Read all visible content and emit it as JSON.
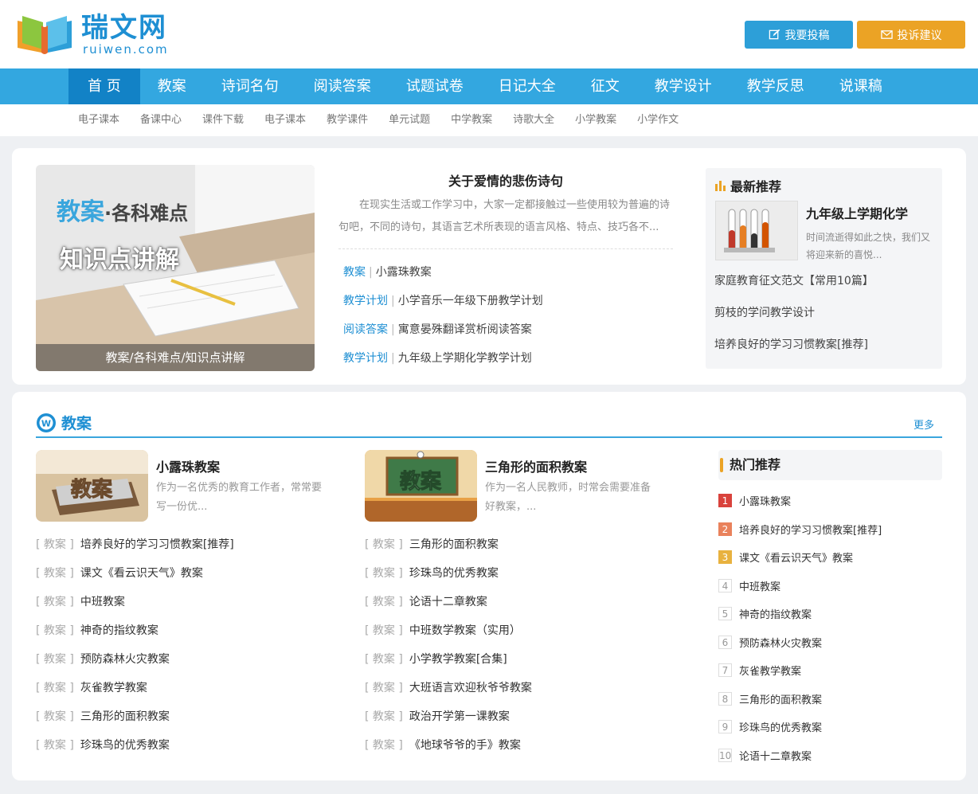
{
  "header": {
    "logo_text": "瑞文网",
    "logo_sub": "ruiwen.com",
    "btn_submit": "我要投稿",
    "btn_feedback": "投诉建议"
  },
  "nav": {
    "items": [
      "首 页",
      "教案",
      "诗词名句",
      "阅读答案",
      "试题试卷",
      "日记大全",
      "征文",
      "教学设计",
      "教学反思",
      "说课稿"
    ]
  },
  "subnav": {
    "items": [
      "电子课本",
      "备课中心",
      "课件下载",
      "电子课本",
      "教学课件",
      "单元试题",
      "中学教案",
      "诗歌大全",
      "小学教案",
      "小学作文"
    ]
  },
  "banner": {
    "title_main": "教案",
    "title_dot": "·各科难点",
    "title_sub": "知识点讲解",
    "caption": "教案/各科难点/知识点讲解"
  },
  "article": {
    "title": "关于爱情的悲伤诗句",
    "desc": "在现实生活或工作学习中，大家一定都接触过一些使用较为普遍的诗句吧，不同的诗句，其语言艺术所表现的语言风格、特点、技巧各不...",
    "links": [
      {
        "tag": "教案",
        "text": "小露珠教案"
      },
      {
        "tag": "教学计划",
        "text": "小学音乐一年级下册教学计划"
      },
      {
        "tag": "阅读答案",
        "text": "寓意晏殊翻译赏析阅读答案"
      },
      {
        "tag": "教学计划",
        "text": "九年级上学期化学教学计划"
      }
    ]
  },
  "latest": {
    "heading": "最新推荐",
    "top_title": "九年级上学期化学",
    "top_desc": "时间流逝得如此之快，我们又将迎来新的喜悦...",
    "items": [
      "家庭教育征文范文【常用10篇】",
      "剪枝的学问教学设计",
      "培养良好的学习习惯教案[推荐]"
    ]
  },
  "section": {
    "title": "教案",
    "more": "更多",
    "feature1": {
      "img_text": "教案",
      "title": "小露珠教案",
      "desc": "作为一名优秀的教育工作者，常常要写一份优..."
    },
    "feature2": {
      "img_text": "教案",
      "title": "三角形的面积教案",
      "desc": "作为一名人民教师，时常会需要准备好教案，..."
    },
    "tag": "[ 教案 ]",
    "list1": [
      "培养良好的学习习惯教案[推荐]",
      "课文《看云识天气》教案",
      "中班教案",
      "神奇的指纹教案",
      "预防森林火灾教案",
      "灰雀教学教案",
      "三角形的面积教案",
      "珍珠鸟的优秀教案"
    ],
    "list2": [
      "三角形的面积教案",
      "珍珠鸟的优秀教案",
      "论语十二章教案",
      "中班数学教案（实用）",
      "小学教学教案[合集]",
      "大班语言欢迎秋爷爷教案",
      "政治开学第一课教案",
      "《地球爷爷的手》教案"
    ]
  },
  "hot": {
    "heading": "热门推荐",
    "items": [
      {
        "num": "1",
        "text": "小露珠教案"
      },
      {
        "num": "2",
        "text": "培养良好的学习习惯教案[推荐]"
      },
      {
        "num": "3",
        "text": "课文《看云识天气》教案"
      },
      {
        "num": "4",
        "text": "中班教案"
      },
      {
        "num": "5",
        "text": "神奇的指纹教案"
      },
      {
        "num": "6",
        "text": "预防森林火灾教案"
      },
      {
        "num": "7",
        "text": "灰雀教学教案"
      },
      {
        "num": "8",
        "text": "三角形的面积教案"
      },
      {
        "num": "9",
        "text": "珍珠鸟的优秀教案"
      },
      {
        "num": "10",
        "text": "论语十二章教案"
      }
    ]
  },
  "colors": {
    "accent": "#33a7e0",
    "nav_active": "#1282c6",
    "orange": "#eba325"
  }
}
